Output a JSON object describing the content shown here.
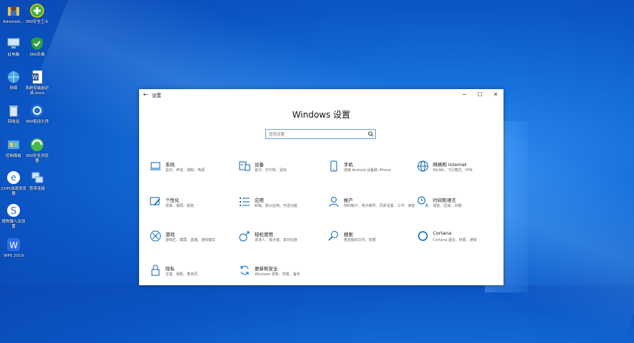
{
  "desktop": {
    "icons": [
      {
        "label": "Administ...",
        "name": "administrator-folder-icon"
      },
      {
        "label": "360安全卫士",
        "name": "360-safe-icon"
      },
      {
        "label": "此电脑",
        "name": "this-pc-icon"
      },
      {
        "label": "360杀毒",
        "name": "360-antivirus-icon"
      },
      {
        "label": "网络",
        "name": "network-icon"
      },
      {
        "label": "系统安装前必读.docx",
        "name": "word-document-icon"
      },
      {
        "label": "回收站",
        "name": "recycle-bin-icon"
      },
      {
        "label": "360驱动大师",
        "name": "360-driver-icon"
      },
      {
        "label": "控制面板",
        "name": "control-panel-icon"
      },
      {
        "label": "360安全浏览器",
        "name": "360-browser-icon"
      },
      {
        "label": "2345加速浏览器",
        "name": "2345-browser-icon"
      },
      {
        "label": "宽带连接",
        "name": "broadband-icon"
      },
      {
        "label": "搜狗输入法设置",
        "name": "sogou-icon"
      },
      {
        "label": "WPS 2019",
        "name": "wps-icon"
      }
    ]
  },
  "window": {
    "title": "设置",
    "back": "←",
    "minimize": "─",
    "maximize": "☐",
    "close": "✕",
    "heading": "Windows 设置",
    "search_placeholder": "查找设置",
    "accent": "#0063b1",
    "tiles": [
      {
        "name": "系统",
        "desc": "显示、声音、通知、电源",
        "icon": "laptop-icon"
      },
      {
        "name": "设备",
        "desc": "蓝牙、打印机、鼠标",
        "icon": "devices-icon"
      },
      {
        "name": "手机",
        "desc": "连接 Android 设备和 iPhone",
        "icon": "phone-icon"
      },
      {
        "name": "网络和 Internet",
        "desc": "WLAN、飞行模式、VPN",
        "icon": "globe-icon"
      },
      {
        "name": "个性化",
        "desc": "背景、锁屏、颜色",
        "icon": "personalization-icon"
      },
      {
        "name": "应用",
        "desc": "卸载、默认应用、可选功能",
        "icon": "apps-icon"
      },
      {
        "name": "帐户",
        "desc": "你的帐户、电子邮件、同步设置、工作、家庭",
        "icon": "account-icon"
      },
      {
        "name": "时间和语言",
        "desc": "语音、区域、日期",
        "icon": "time-language-icon"
      },
      {
        "name": "游戏",
        "desc": "游戏栏、截屏、直播、游戏模式",
        "icon": "xbox-icon"
      },
      {
        "name": "轻松使用",
        "desc": "讲述人、放大镜、高对比度",
        "icon": "ease-of-access-icon"
      },
      {
        "name": "搜索",
        "desc": "查找我的文件、权限",
        "icon": "search-icon"
      },
      {
        "name": "Cortana",
        "desc": "Cortana 语言、权限、通知",
        "icon": "cortana-icon"
      },
      {
        "name": "隐私",
        "desc": "位置、相机、麦克风",
        "icon": "lock-icon"
      },
      {
        "name": "更新和安全",
        "desc": "Windows 更新、恢复、备份",
        "icon": "update-icon"
      }
    ]
  }
}
